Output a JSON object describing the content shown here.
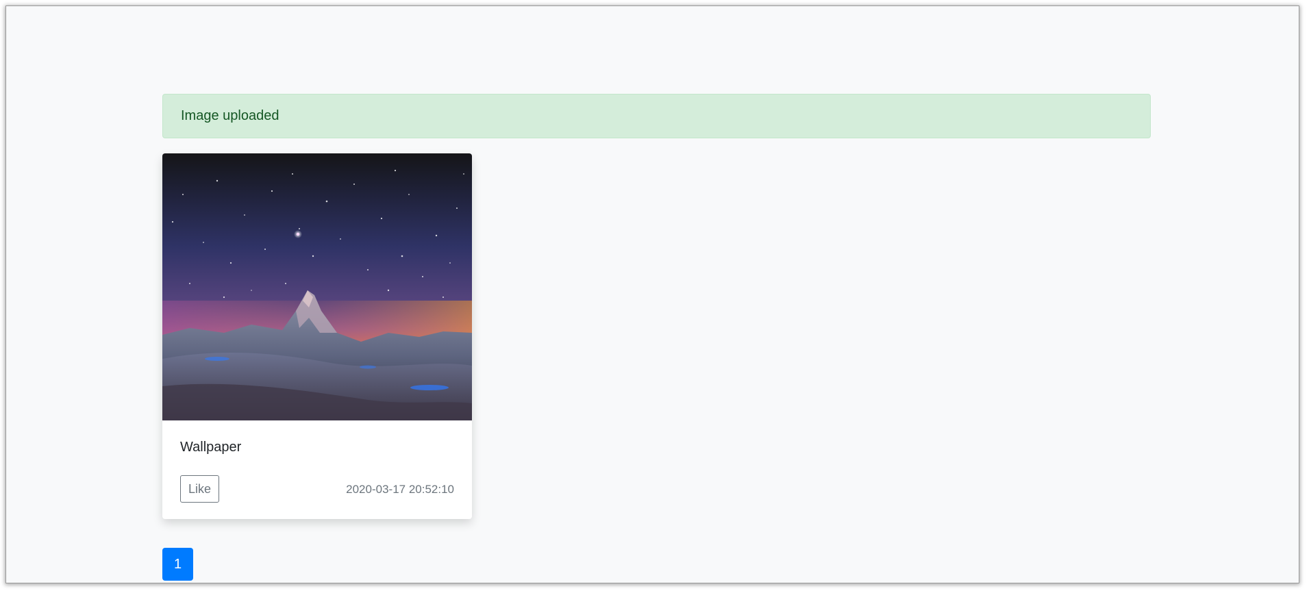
{
  "alert": {
    "message": "Image uploaded",
    "color": "#155724",
    "background": "#d4edda"
  },
  "cards": [
    {
      "image_description": "starry night sky over a snowy mountain peak",
      "title": "Wallpaper",
      "like_label": "Like",
      "timestamp": "2020-03-17 20:52:10"
    }
  ],
  "pagination": {
    "pages": [
      "1"
    ],
    "active_page": "1",
    "accent": "#007bff"
  }
}
